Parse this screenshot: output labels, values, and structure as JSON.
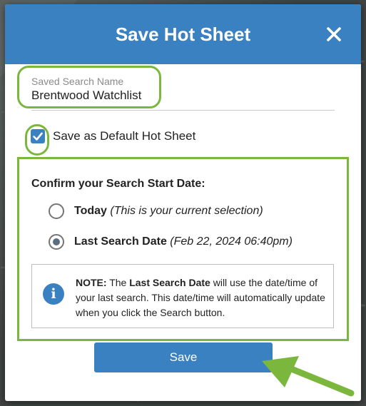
{
  "dialog": {
    "title": "Save Hot Sheet",
    "close_icon": "close-icon"
  },
  "saved_search_name": {
    "label": "Saved Search Name",
    "value": "Brentwood Watchlist"
  },
  "default_checkbox": {
    "label": "Save as Default Hot Sheet",
    "checked": true
  },
  "start_date": {
    "title": "Confirm your Search Start Date:",
    "options": [
      {
        "label": "Today",
        "detail": "(This is your current selection)",
        "selected": false
      },
      {
        "label": "Last Search Date",
        "detail": "(Feb 22, 2024 06:40pm)",
        "selected": true
      }
    ]
  },
  "note": {
    "icon": "info-icon",
    "prefix": "NOTE:",
    "text_a": "The",
    "emphasis": "Last Search Date",
    "text_b": "will use the date/time of your last search. This date/time will automatically update when you click the Search button."
  },
  "save_button": {
    "label": "Save"
  },
  "colors": {
    "header": "#3a81c2",
    "highlight": "#7bb73d",
    "button": "#3a81c2"
  }
}
